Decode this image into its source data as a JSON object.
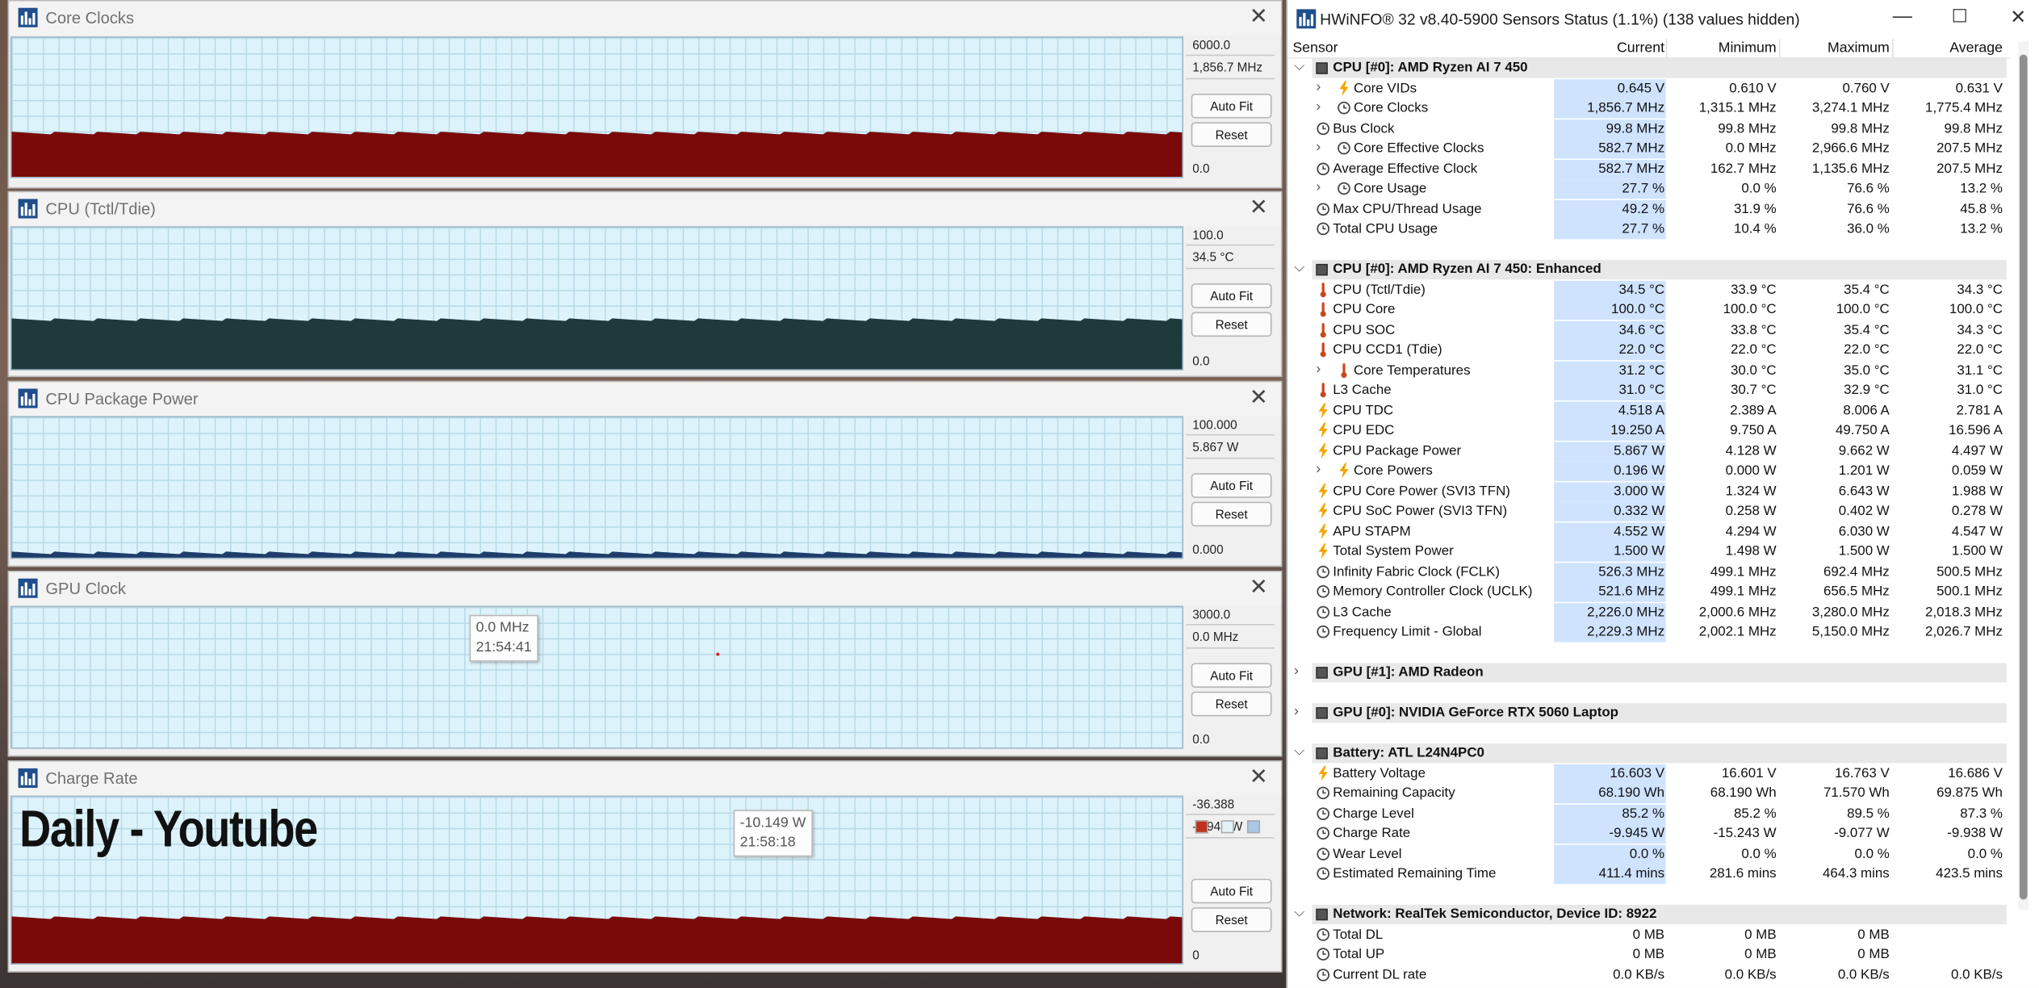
{
  "colors": {
    "plot_bg": "#ddf3fb",
    "grid": "#b7d9e7",
    "dark_red": "#7a0a0a",
    "dark_teal": "#1f3a3d",
    "dark_blue": "#1f3d6a",
    "current_col_bg": "#cfe3ff",
    "group_bg": "#e8e8e8"
  },
  "graphs": [
    {
      "title": "Core Clocks",
      "max": "6000.0",
      "current": "1,856.7 MHz",
      "min": "0.0",
      "auto_fit": "Auto Fit",
      "reset": "Reset",
      "close": "✕",
      "fill_level": 0.31,
      "fill_color": "#7a0a0a"
    },
    {
      "title": "CPU (Tctl/Tdie)",
      "max": "100.0",
      "current": "34.5 °C",
      "min": "0.0",
      "auto_fit": "Auto Fit",
      "reset": "Reset",
      "close": "✕",
      "fill_level": 0.345,
      "fill_color": "#1f3a3d"
    },
    {
      "title": "CPU Package Power",
      "max": "100.000",
      "current": "5.867 W",
      "min": "0.000",
      "auto_fit": "Auto Fit",
      "reset": "Reset",
      "close": "✕",
      "fill_level": 0.03,
      "fill_color": "#1f3d6a"
    },
    {
      "title": "GPU Clock",
      "max": "3000.0",
      "current": "0.0 MHz",
      "min": "0.0",
      "auto_fit": "Auto Fit",
      "reset": "Reset",
      "close": "✕",
      "fill_level": 0.0,
      "fill_color": "#7a0a0a",
      "tooltip": {
        "value": "0.0 MHz",
        "time": "21:54:41"
      }
    },
    {
      "title": "Charge Rate",
      "max": "-36.388",
      "current": "-9.945 W",
      "min": "0",
      "auto_fit": "Auto Fit",
      "reset": "Reset",
      "close": "✕",
      "fill_level": 0.27,
      "fill_color": "#7a0a0a",
      "tooltip": {
        "value": "-10.149 W",
        "time": "21:58:18"
      },
      "overlay": "Daily - Youtube",
      "swatches": [
        "#c0321f",
        "#e4f1f8",
        "#a9c8e8"
      ]
    }
  ],
  "hwinfo": {
    "title": "HWiNFO® 32 v8.40-5900 Sensors Status (1.1%) (138 values hidden)",
    "btn_min": "—",
    "btn_max": "☐",
    "btn_close": "✕",
    "columns": [
      "Sensor",
      "Current",
      "Minimum",
      "Maximum",
      "Average"
    ],
    "rows": [
      {
        "type": "group",
        "name": "CPU [#0]: AMD Ryzen AI 7 450",
        "expanded": true
      },
      {
        "name": "Core VIDs",
        "icon": "bolt",
        "expandable": true,
        "values": [
          "0.645 V",
          "0.610 V",
          "0.760 V",
          "0.631 V"
        ]
      },
      {
        "name": "Core Clocks",
        "icon": "clock",
        "expandable": true,
        "values": [
          "1,856.7 MHz",
          "1,315.1 MHz",
          "3,274.1 MHz",
          "1,775.4 MHz"
        ]
      },
      {
        "name": "Bus Clock",
        "icon": "clock",
        "values": [
          "99.8 MHz",
          "99.8 MHz",
          "99.8 MHz",
          "99.8 MHz"
        ]
      },
      {
        "name": "Core Effective Clocks",
        "icon": "clock",
        "expandable": true,
        "values": [
          "582.7 MHz",
          "0.0 MHz",
          "2,966.6 MHz",
          "207.5 MHz"
        ]
      },
      {
        "name": "Average Effective Clock",
        "icon": "clock",
        "values": [
          "582.7 MHz",
          "162.7 MHz",
          "1,135.6 MHz",
          "207.5 MHz"
        ]
      },
      {
        "name": "Core Usage",
        "icon": "clock",
        "expandable": true,
        "values": [
          "27.7 %",
          "0.0 %",
          "76.6 %",
          "13.2 %"
        ]
      },
      {
        "name": "Max CPU/Thread Usage",
        "icon": "clock",
        "values": [
          "49.2 %",
          "31.9 %",
          "76.6 %",
          "45.8 %"
        ]
      },
      {
        "name": "Total CPU Usage",
        "icon": "clock",
        "values": [
          "27.7 %",
          "10.4 %",
          "36.0 %",
          "13.2 %"
        ]
      },
      {
        "type": "spacer"
      },
      {
        "type": "group",
        "name": "CPU [#0]: AMD Ryzen AI 7 450: Enhanced",
        "expanded": true
      },
      {
        "name": "CPU (Tctl/Tdie)",
        "icon": "temp",
        "values": [
          "34.5 °C",
          "33.9 °C",
          "35.4 °C",
          "34.3 °C"
        ]
      },
      {
        "name": "CPU Core",
        "icon": "temp",
        "values": [
          "100.0 °C",
          "100.0 °C",
          "100.0 °C",
          "100.0 °C"
        ]
      },
      {
        "name": "CPU SOC",
        "icon": "temp",
        "values": [
          "34.6 °C",
          "33.8 °C",
          "35.4 °C",
          "34.3 °C"
        ]
      },
      {
        "name": "CPU CCD1 (Tdie)",
        "icon": "temp",
        "values": [
          "22.0 °C",
          "22.0 °C",
          "22.0 °C",
          "22.0 °C"
        ]
      },
      {
        "name": "Core Temperatures",
        "icon": "temp",
        "expandable": true,
        "values": [
          "31.2 °C",
          "30.0 °C",
          "35.0 °C",
          "31.1 °C"
        ]
      },
      {
        "name": "L3 Cache",
        "icon": "temp",
        "values": [
          "31.0 °C",
          "30.7 °C",
          "32.9 °C",
          "31.0 °C"
        ]
      },
      {
        "name": "CPU TDC",
        "icon": "bolt",
        "values": [
          "4.518 A",
          "2.389 A",
          "8.006 A",
          "2.781 A"
        ]
      },
      {
        "name": "CPU EDC",
        "icon": "bolt",
        "values": [
          "19.250 A",
          "9.750 A",
          "49.750 A",
          "16.596 A"
        ]
      },
      {
        "name": "CPU Package Power",
        "icon": "bolt",
        "values": [
          "5.867 W",
          "4.128 W",
          "9.662 W",
          "4.497 W"
        ]
      },
      {
        "name": "Core Powers",
        "icon": "bolt",
        "expandable": true,
        "values": [
          "0.196 W",
          "0.000 W",
          "1.201 W",
          "0.059 W"
        ]
      },
      {
        "name": "CPU Core Power (SVI3 TFN)",
        "icon": "bolt",
        "values": [
          "3.000 W",
          "1.324 W",
          "6.643 W",
          "1.988 W"
        ]
      },
      {
        "name": "CPU SoC Power (SVI3 TFN)",
        "icon": "bolt",
        "values": [
          "0.332 W",
          "0.258 W",
          "0.402 W",
          "0.278 W"
        ]
      },
      {
        "name": "APU STAPM",
        "icon": "bolt",
        "values": [
          "4.552 W",
          "4.294 W",
          "6.030 W",
          "4.547 W"
        ]
      },
      {
        "name": "Total System Power",
        "icon": "bolt",
        "values": [
          "1.500 W",
          "1.498 W",
          "1.500 W",
          "1.500 W"
        ]
      },
      {
        "name": "Infinity Fabric Clock (FCLK)",
        "icon": "clock",
        "values": [
          "526.3 MHz",
          "499.1 MHz",
          "692.4 MHz",
          "500.5 MHz"
        ]
      },
      {
        "name": "Memory Controller Clock (UCLK)",
        "icon": "clock",
        "values": [
          "521.6 MHz",
          "499.1 MHz",
          "656.5 MHz",
          "500.1 MHz"
        ]
      },
      {
        "name": "L3 Cache",
        "icon": "clock",
        "values": [
          "2,226.0 MHz",
          "2,000.6 MHz",
          "3,280.0 MHz",
          "2,018.3 MHz"
        ]
      },
      {
        "name": "Frequency Limit - Global",
        "icon": "clock",
        "values": [
          "2,229.3 MHz",
          "2,002.1 MHz",
          "5,150.0 MHz",
          "2,026.7 MHz"
        ]
      },
      {
        "type": "spacer"
      },
      {
        "type": "group",
        "name": "GPU [#1]: AMD Radeon",
        "expanded": false
      },
      {
        "type": "spacer"
      },
      {
        "type": "group",
        "name": "GPU [#0]: NVIDIA GeForce RTX 5060 Laptop",
        "expanded": false
      },
      {
        "type": "spacer"
      },
      {
        "type": "group",
        "name": "Battery: ATL L24N4PC0",
        "expanded": true
      },
      {
        "name": "Battery Voltage",
        "icon": "bolt",
        "values": [
          "16.603 V",
          "16.601 V",
          "16.763 V",
          "16.686 V"
        ]
      },
      {
        "name": "Remaining Capacity",
        "icon": "clock",
        "values": [
          "68.190 Wh",
          "68.190 Wh",
          "71.570 Wh",
          "69.875 Wh"
        ]
      },
      {
        "name": "Charge Level",
        "icon": "clock",
        "values": [
          "85.2 %",
          "85.2 %",
          "89.5 %",
          "87.3 %"
        ]
      },
      {
        "name": "Charge Rate",
        "icon": "clock",
        "values": [
          "-9.945 W",
          "-15.243 W",
          "-9.077 W",
          "-9.938 W"
        ]
      },
      {
        "name": "Wear Level",
        "icon": "clock",
        "values": [
          "0.0 %",
          "0.0 %",
          "0.0 %",
          "0.0 %"
        ]
      },
      {
        "name": "Estimated Remaining Time",
        "icon": "clock",
        "values": [
          "411.4 mins",
          "281.6 mins",
          "464.3 mins",
          "423.5 mins"
        ]
      },
      {
        "type": "spacer"
      },
      {
        "type": "group",
        "name": "Network: RealTek Semiconductor, Device ID: 8922",
        "expanded": true
      },
      {
        "name": "Total DL",
        "icon": "clock",
        "nohl": true,
        "values": [
          "0 MB",
          "0 MB",
          "0 MB",
          ""
        ]
      },
      {
        "name": "Total UP",
        "icon": "clock",
        "nohl": true,
        "values": [
          "0 MB",
          "0 MB",
          "0 MB",
          ""
        ]
      },
      {
        "name": "Current DL rate",
        "icon": "clock",
        "nohl": true,
        "values": [
          "0.0 KB/s",
          "0.0 KB/s",
          "0.0 KB/s",
          "0.0 KB/s"
        ]
      }
    ]
  }
}
